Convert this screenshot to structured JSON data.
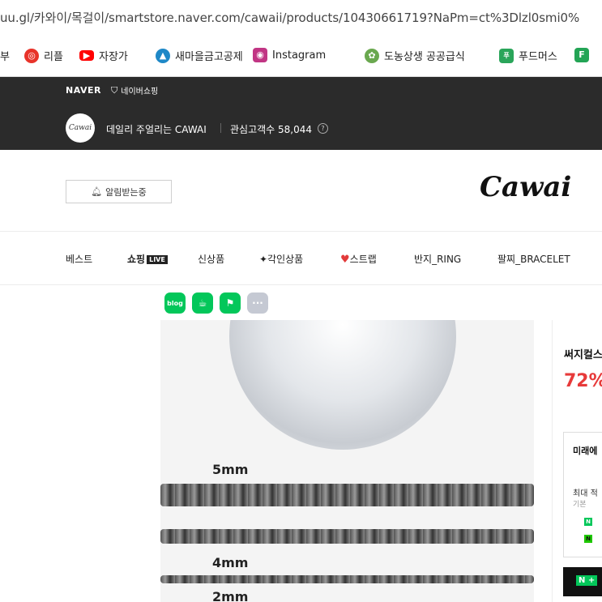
{
  "browser": {
    "url": "uu.gl/카와이/목걸이/smartstore.naver.com/cawaii/products/10430661719?NaPm=ct%3Dlzl0smi0%"
  },
  "bookmarks": [
    {
      "label": "부",
      "icon": "folder-icon",
      "color": "#ffffff"
    },
    {
      "label": "리플",
      "icon": "repl-icon",
      "color": "#e8332a"
    },
    {
      "label": "자장가",
      "icon": "youtube-icon",
      "color": "#ff0000"
    },
    {
      "label": "새마을금고공제",
      "icon": "mg-icon",
      "color": "#1e88c7"
    },
    {
      "label": "Instagram",
      "icon": "instagram-icon",
      "color": "#c13584"
    },
    {
      "label": "도농상생 공공급식",
      "icon": "gov-icon",
      "color": "#6aa84f"
    },
    {
      "label": "푸드머스",
      "icon": "foodmerce-icon",
      "color": "#2aa55a"
    },
    {
      "label": "F",
      "icon": "f-icon",
      "color": "#23a455"
    }
  ],
  "store_header": {
    "naver_label": "NAVER",
    "shopping_label": "네이버쇼핑",
    "logo_text": "Cawai",
    "store_name": "데일리 주얼리는 CAWAI",
    "followers_label": "관심고객수 58,044"
  },
  "store_top": {
    "alert_button": "알림받는중",
    "brand_logo": "Cawai"
  },
  "nav": [
    {
      "label": "베스트"
    },
    {
      "label": "쇼핑",
      "badge": "LIVE"
    },
    {
      "label": "신상품"
    },
    {
      "label": "✦각인상품"
    },
    {
      "label": "스트랩",
      "icon": "heart-icon"
    },
    {
      "label": "반지_RING"
    },
    {
      "label": "팔찌_BRACELET"
    }
  ],
  "share": [
    {
      "label": "blog",
      "icon": "blog-icon",
      "color": "#03c75a"
    },
    {
      "label": "",
      "icon": "cafe-icon",
      "color": "#03c75a"
    },
    {
      "label": "",
      "icon": "bookmark-icon",
      "color": "#03c75a"
    },
    {
      "label": "···",
      "icon": "more-icon",
      "color": "#c5c9d3"
    }
  ],
  "product_image": {
    "labels": [
      "5mm",
      "4mm",
      "2mm"
    ]
  },
  "product": {
    "title": "써지컬스",
    "discount": "72%"
  },
  "benefit": {
    "title": "미래에",
    "sub": "최대 적",
    "small": "기본",
    "npay_bar": "N +"
  }
}
